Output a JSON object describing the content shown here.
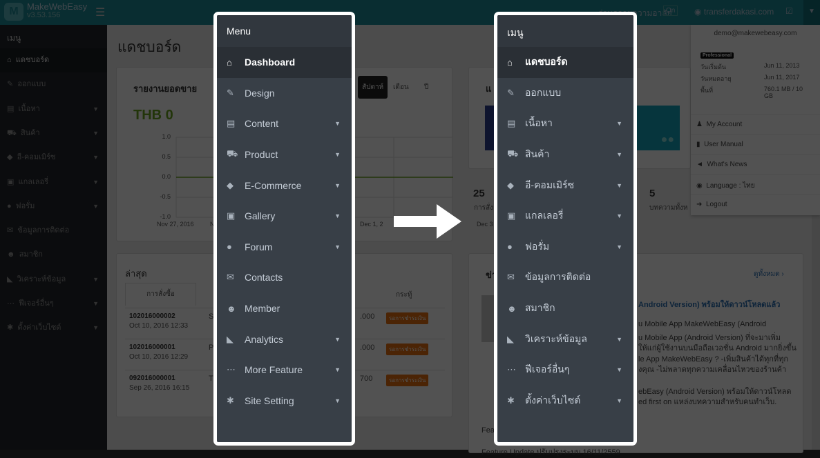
{
  "topbar": {
    "brand": "MakeWebEasy",
    "version": "v3.53.156",
    "mourning_label": "ร่วมถวายความอาลัย",
    "toggle": "On",
    "domain": "transferdakasi.com"
  },
  "sidebar": {
    "header": "เมนู",
    "items": [
      {
        "label": "แดชบอร์ด",
        "icon": "home-icon"
      },
      {
        "label": "ออกแบบ",
        "icon": "brush-icon"
      },
      {
        "label": "เนื้อหา",
        "icon": "file-icon",
        "caret": true
      },
      {
        "label": "สินค้า",
        "icon": "cart-icon",
        "caret": true
      },
      {
        "label": "อี-คอมเมิร์ซ",
        "icon": "tag-icon",
        "caret": true
      },
      {
        "label": "แกลเลอรี่",
        "icon": "image-icon",
        "caret": true
      },
      {
        "label": "ฟอรั่ม",
        "icon": "comments-icon",
        "caret": true
      },
      {
        "label": "ข้อมูลการติดต่อ",
        "icon": "envelope-icon"
      },
      {
        "label": "สมาชิก",
        "icon": "users-icon"
      },
      {
        "label": "วิเคราะห์ข้อมูล",
        "icon": "area-chart-icon",
        "caret": true
      },
      {
        "label": "ฟีเจอร์อื่นๆ",
        "icon": "ellipsis-icon",
        "caret": true
      },
      {
        "label": "ตั้งค่าเว็บไซต์",
        "icon": "gear-icon",
        "caret": true
      }
    ]
  },
  "dashboard": {
    "title": "แดชบอร์ด",
    "sales": {
      "title": "รายงานยอดขาย",
      "tabs": [
        "สัปดาห์",
        "เดือน",
        "ปี"
      ],
      "total": "THB 0",
      "y_ticks": [
        "1.0",
        "0.5",
        "0.0",
        "-0.5",
        "-1.0"
      ],
      "x_ticks": [
        "Nov 27, 2016",
        "N",
        "Dec 1, 2"
      ]
    },
    "latest": {
      "title": "ล่าสุด",
      "tab": "การสั่งซื้อ",
      "col_right": "กระทู้",
      "rows": [
        {
          "id": "102016000002",
          "date": "Oct 10, 2016 12:33",
          "name": "S",
          "amount": ".000",
          "status": "รอการชำระเงิน"
        },
        {
          "id": "102016000001",
          "date": "Oct 10, 2016 12:29",
          "name": "P",
          "amount": ".000",
          "status": "รอการชำระเงิน"
        },
        {
          "id": "092016000001",
          "date": "Sep 26, 2016 16:15",
          "name": "T",
          "amount": "700",
          "status": "รอการชำระเงิน"
        }
      ]
    },
    "stats": [
      {
        "value": "25",
        "label": "การสั่ง"
      },
      {
        "value": "5",
        "label": "บทความทั้งห"
      }
    ],
    "stats_date": "Dec 3",
    "card2_title": "แ",
    "news": {
      "title": "ข่า",
      "view_all": "ดูทั้งหมด ›",
      "headline": "Android Version) พร้อมให้ดาวน์โหลดแล้ว",
      "lines": [
        "u Mobile App MakeWebEasy (Android",
        "u Mobile App (Android Version) ที่จะมาเพิ่ม",
        "ให้แก่ผู้ใช้งานบนมือถือเวอชั่น Android มากยิ่งขึ้น",
        "le App MakeWebEasy ? -เพิ่มสินค้าได้ทุกที่ทุก",
        "งคุณ -ไม่พลาดทุกความเคลื่อนไหวของร้านค้า",
        "",
        "ebEasy (Android Version) พร้อมให้ดาวน์โหลด",
        "ed first on แหล่งบทความสำหรับคนทำเว็บ."
      ],
      "item2": "Fea",
      "item3": "Feature Update ปรับปรุงระบบ 16/11/2559"
    }
  },
  "account": {
    "email": "demo@makewebeasy.com",
    "plan": "Professional",
    "rows": [
      {
        "k": "วันเริ่มต้น",
        "v": "Jun 11, 2013"
      },
      {
        "k": "วันหมดอายุ",
        "v": "Jun 11, 2017"
      },
      {
        "k": "พื้นที่",
        "v": "760.1 MB / 10 GB"
      }
    ],
    "menu": [
      {
        "label": "My Account",
        "icon": "user-icon"
      },
      {
        "label": "User Manual",
        "icon": "book-icon"
      },
      {
        "label": "What's News",
        "icon": "bullhorn-icon"
      },
      {
        "label": "Language : ไทย",
        "icon": "globe-icon"
      },
      {
        "label": "Logout",
        "icon": "sign-out-icon"
      }
    ]
  },
  "panel_en": {
    "header": "Menu",
    "items": [
      "Dashboard",
      "Design",
      "Content",
      "Product",
      "E-Commerce",
      "Gallery",
      "Forum",
      "Contacts",
      "Member",
      "Analytics",
      "More Feature",
      "Site Setting"
    ]
  },
  "panel_th": {
    "header": "เมนู",
    "items": [
      "แดชบอร์ด",
      "ออกแบบ",
      "เนื้อหา",
      "สินค้า",
      "อี-คอมเมิร์ซ",
      "แกลเลอรี่",
      "ฟอรั่ม",
      "ข้อมูลการติดต่อ",
      "สมาชิก",
      "วิเคราะห์ข้อมูล",
      "ฟีเจอร์อื่นๆ",
      "ตั้งค่าเว็บไซต์"
    ]
  },
  "colors": {
    "topbar": "#1c8c99",
    "panel": "#383f47",
    "accent_green": "#6aa51e",
    "badge": "#e9720f"
  }
}
